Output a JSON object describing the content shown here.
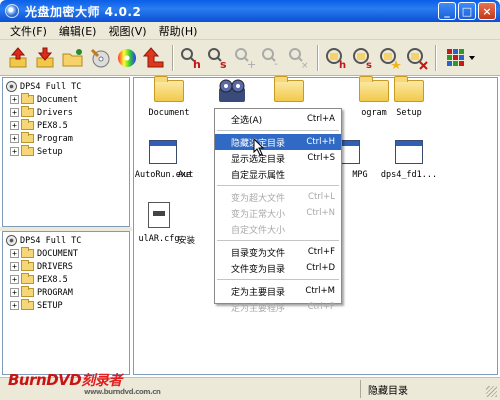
{
  "window": {
    "title": "光盘加密大师 4.0.2",
    "buttons": [
      "_",
      "□",
      "×"
    ]
  },
  "menu": [
    "文件(F)",
    "编辑(E)",
    "视图(V)",
    "帮助(H)"
  ],
  "toolbar_icons": [
    "open-red-arrow-icon",
    "save-down-arrow-icon",
    "open-folder-icon",
    "burn-disc-icon",
    "color-disc-icon",
    "up-arrow-icon",
    "hide-h-icon",
    "show-s-icon",
    "shrink-icon",
    "enlarge-icon",
    "remove-icon",
    "hide-folder-h-icon",
    "show-folder-s-icon",
    "star-folder-icon",
    "delete-folder-icon",
    "view-grid-icon"
  ],
  "tree_top": {
    "root": "DPS4 Full TC",
    "items": [
      "Document",
      "Drivers",
      "PEX8.5",
      "Program",
      "Setup"
    ]
  },
  "tree_bottom": {
    "root": "DPS4 Full TC",
    "items": [
      "DOCUMENT",
      "DRIVERS",
      "PEX8.5",
      "PROGRAM",
      "SETUP"
    ]
  },
  "files": {
    "document": "Document",
    "selected": "D",
    "program": "ogram",
    "setup": "Setup",
    "autorun": "AutoRun.exe",
    "aut": "Aut",
    "mpg": "MPG",
    "dps4": "dps4_fd1...",
    "ular": "ulAR.cfg",
    "anzhuang": "安装"
  },
  "context_menu": {
    "select_all": {
      "label": "全选(A)",
      "shortcut": "Ctrl+A"
    },
    "hide_dir": {
      "label": "隐藏选定目录",
      "shortcut": "Ctrl+H"
    },
    "show_dir": {
      "label": "显示选定目录",
      "shortcut": "Ctrl+S"
    },
    "custom_attr": {
      "label": "自定显示属性",
      "shortcut": ""
    },
    "make_huge": {
      "label": "变为超大文件",
      "shortcut": "Ctrl+L"
    },
    "make_normal": {
      "label": "变为正常大小",
      "shortcut": "Ctrl+N"
    },
    "custom_size": {
      "label": "自定文件大小",
      "shortcut": ""
    },
    "dir_to_file": {
      "label": "目录变为文件",
      "shortcut": "Ctrl+F"
    },
    "file_to_dir": {
      "label": "文件变为目录",
      "shortcut": "Ctrl+D"
    },
    "set_main": {
      "label": "定为主要目录",
      "shortcut": "Ctrl+M"
    },
    "set_main_prog": {
      "label": "定为主要程序",
      "shortcut": "Ctrl+P"
    }
  },
  "status": {
    "text": "隐藏目录"
  },
  "watermark": {
    "brand": "BurnDVD",
    "cn": "刻录者",
    "url": "www.burndvd.com.cn"
  },
  "colors": {
    "title_blue": "#0a5ee8",
    "highlight": "#316ac5",
    "face": "#ece9d8",
    "watermark_red": "#c81414"
  }
}
